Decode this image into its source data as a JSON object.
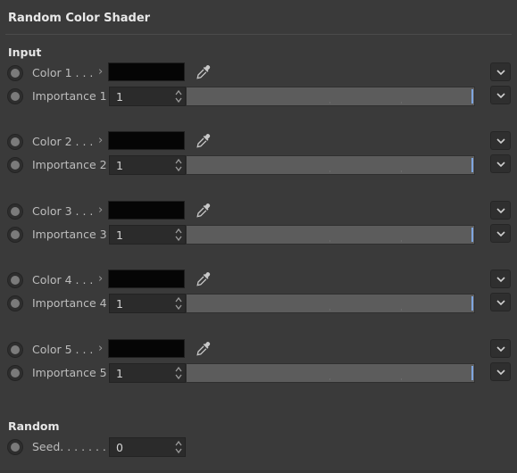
{
  "panel": {
    "title": "Random Color Shader"
  },
  "input": {
    "header": "Input",
    "entries": [
      {
        "color_label": "Color 1 . . .",
        "importance_label": "Importance 1",
        "importance_value": "1",
        "importance_fraction": 1.0,
        "color": "#050505"
      },
      {
        "color_label": "Color 2 . . .",
        "importance_label": "Importance 2",
        "importance_value": "1",
        "importance_fraction": 1.0,
        "color": "#050505"
      },
      {
        "color_label": "Color 3 . . .",
        "importance_label": "Importance 3",
        "importance_value": "1",
        "importance_fraction": 1.0,
        "color": "#050505"
      },
      {
        "color_label": "Color 4 . . .",
        "importance_label": "Importance 4",
        "importance_value": "1",
        "importance_fraction": 1.0,
        "color": "#050505"
      },
      {
        "color_label": "Color 5 . . .",
        "importance_label": "Importance 5",
        "importance_value": "1",
        "importance_fraction": 1.0,
        "color": "#050505"
      }
    ]
  },
  "random": {
    "header": "Random",
    "seed_label": "Seed. . . . . . .",
    "seed_value": "0"
  },
  "icons": {
    "animation_toggle": "radio-icon",
    "expand": "chevron-right-icon",
    "picker": "eyedropper-icon",
    "menu": "chevron-down-icon",
    "spinner": "spinner-arrows-icon"
  },
  "colors": {
    "background": "#3a3a3a",
    "slider_handle": "#7ea6e0",
    "swatch": "#050505"
  }
}
